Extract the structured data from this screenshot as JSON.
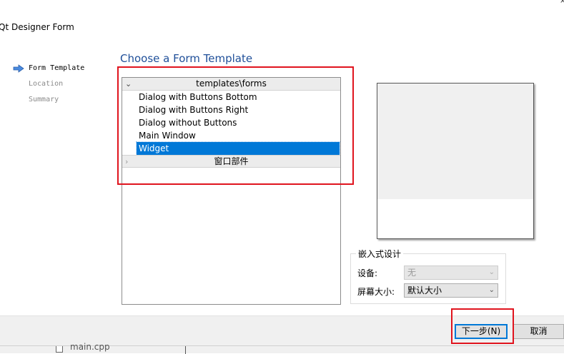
{
  "window": {
    "title": "Qt Designer Form"
  },
  "steps": [
    {
      "label": "Form Template",
      "active": true
    },
    {
      "label": "Location",
      "active": false
    },
    {
      "label": "Summary",
      "active": false
    }
  ],
  "page": {
    "heading": "Choose a Form Template"
  },
  "template_tree": {
    "groups": [
      {
        "label": "templates\\forms",
        "expanded": true,
        "items": [
          "Dialog with Buttons Bottom",
          "Dialog with Buttons Right",
          "Dialog without Buttons",
          "Main Window",
          "Widget"
        ],
        "selected": "Widget"
      },
      {
        "label": "窗口部件",
        "expanded": false
      }
    ]
  },
  "embedded_design": {
    "title": "嵌入式设计",
    "device_label": "设备:",
    "device_value": "无",
    "screen_size_label": "屏幕大小:",
    "screen_size_value": "默认大小"
  },
  "buttons": {
    "next": "下一步(N)",
    "cancel": "取消"
  },
  "taskbar": {
    "file_label": "main.cpp"
  },
  "colors": {
    "heading": "#1f4f99",
    "selection": "#0078d7",
    "annotation": "#e0141e"
  }
}
